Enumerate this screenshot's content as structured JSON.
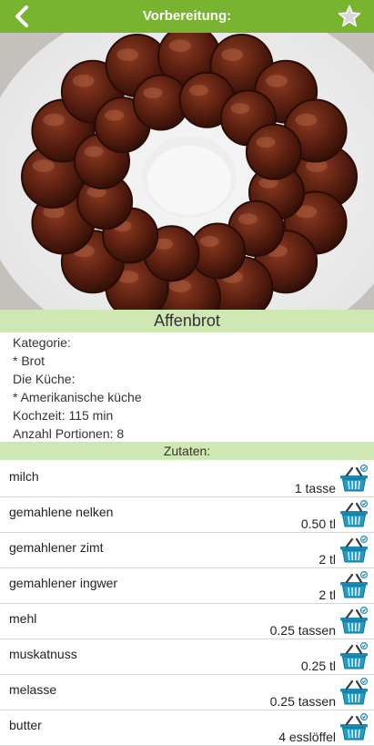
{
  "header": {
    "title": "Vorbereitung:",
    "back_icon": "chevron-left-icon",
    "favorite_icon": "star-icon"
  },
  "colors": {
    "primary": "#78b430",
    "section": "#cfe7b3",
    "basket": "#1a8ab4"
  },
  "recipe": {
    "title": "Affenbrot",
    "info": [
      "Kategorie:",
      "* Brot",
      "Die Küche:",
      "* Amerikanische küche",
      "Kochzeit: 115 min",
      "Anzahl Portionen: 8"
    ]
  },
  "ingredients_section": {
    "title": "Zutaten:"
  },
  "ingredients": [
    {
      "name": "milch",
      "amount": "1 tasse"
    },
    {
      "name": "gemahlene nelken",
      "amount": "0.50 tl"
    },
    {
      "name": "gemahlener zimt",
      "amount": "2 tl"
    },
    {
      "name": "gemahlener ingwer",
      "amount": "2 tl"
    },
    {
      "name": "mehl",
      "amount": "0.25 tassen"
    },
    {
      "name": "muskatnuss",
      "amount": "0.25 tl"
    },
    {
      "name": "melasse",
      "amount": "0.25 tassen"
    },
    {
      "name": "butter",
      "amount": "4 esslöffel"
    }
  ]
}
